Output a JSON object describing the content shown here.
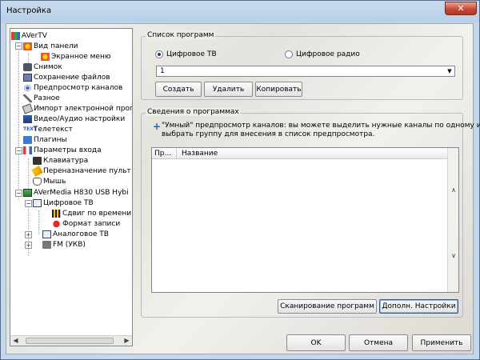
{
  "window": {
    "title": "Настройка",
    "close_label": "✕"
  },
  "tree": {
    "items": [
      {
        "label": "AVerTV",
        "icon": "avertv-icon"
      },
      {
        "label": "Вид панели",
        "icon": "panel-view-icon"
      },
      {
        "label": "Экранное меню",
        "icon": "osd-menu-icon"
      },
      {
        "label": "Снимок",
        "icon": "snapshot-icon"
      },
      {
        "label": "Сохранение файлов",
        "icon": "save-files-icon"
      },
      {
        "label": "Предпросмотр каналов",
        "icon": "channel-preview-icon"
      },
      {
        "label": "Разное",
        "icon": "misc-icon"
      },
      {
        "label": "Импорт электронной прог",
        "icon": "epg-import-icon"
      },
      {
        "label": "Видео/Аудио настройки",
        "icon": "video-audio-icon"
      },
      {
        "label": "Телетекст",
        "icon": "teletext-icon"
      },
      {
        "label": "Плагины",
        "icon": "plugins-icon"
      },
      {
        "label": "Параметры входа",
        "icon": "input-params-icon"
      },
      {
        "label": "Клавиатура",
        "icon": "keyboard-icon"
      },
      {
        "label": "Переназначение пульт",
        "icon": "remote-remap-icon"
      },
      {
        "label": "Мышь",
        "icon": "mouse-icon"
      },
      {
        "label": "AVerMedia H830 USB Hybi",
        "icon": "device-icon"
      },
      {
        "label": "Цифровое ТВ",
        "icon": "digital-tv-icon"
      },
      {
        "label": "Сдвиг по времени",
        "icon": "timeshift-icon"
      },
      {
        "label": "Формат записи",
        "icon": "record-format-icon"
      },
      {
        "label": "Аналоговое ТВ",
        "icon": "analog-tv-icon"
      },
      {
        "label": "FM (УКВ)",
        "icon": "fm-radio-icon"
      }
    ],
    "expanders": [
      "−",
      "−",
      "−",
      "−",
      "+",
      "+"
    ]
  },
  "program_list": {
    "group_label": "Список программ",
    "radio_digital_tv": "Цифровое ТВ",
    "radio_digital_radio": "Цифровое радио",
    "combo_value": "1",
    "btn_create": "Создать",
    "btn_delete": "Удалить",
    "btn_copy": "Копировать"
  },
  "program_info": {
    "group_label": "Сведения о программах",
    "info_line1": "\"Умный\" предпросмотр каналов: вы можете выделить нужные каналы по одному или",
    "info_line2": "выбрать группу для внесения в список предпросмотра.",
    "col_pr": "Пр...",
    "col_name": "Название",
    "btn_scan": "Сканирование программ",
    "btn_more_settings": "Дополн. Настройки"
  },
  "footer": {
    "ok": "OK",
    "cancel": "Отмена",
    "apply": "Применить"
  },
  "colors": {
    "accent": "#2f5b8c",
    "title_bg": "#c5d7ea",
    "close": "#c94a36"
  }
}
